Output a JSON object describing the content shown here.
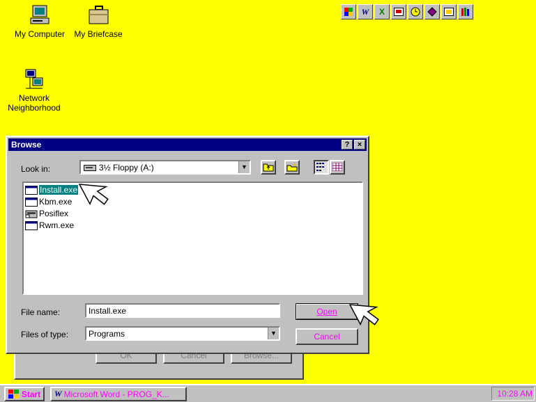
{
  "desktop": {
    "icons": [
      {
        "label": "My Computer"
      },
      {
        "label": "My Briefcase"
      },
      {
        "label": "Network Neighborhood"
      }
    ]
  },
  "office_toolbar": {
    "buttons": [
      "office-logo-icon",
      "word-icon",
      "excel-icon",
      "powerpoint-icon",
      "schedule-icon",
      "access-icon",
      "binder-icon",
      "bookshelf-icon"
    ],
    "word_glyph": "W",
    "excel_glyph": "X"
  },
  "behind_dialog": {
    "buttons": [
      "OK",
      "Cancel",
      "Browse..."
    ]
  },
  "dialog": {
    "title": "Browse",
    "help_glyph": "?",
    "close_glyph": "×",
    "look_in_label": "Look in:",
    "look_in_value": "3½ Floppy (A:)",
    "files": [
      {
        "name": "Install.exe",
        "selected": true
      },
      {
        "name": "Kbm.exe",
        "selected": false
      },
      {
        "name": "Posiflex",
        "selected": false
      },
      {
        "name": "Rwm.exe",
        "selected": false
      }
    ],
    "file_name_label": "File name:",
    "file_name_value": "Install.exe",
    "files_of_type_label": "Files of type:",
    "files_of_type_value": "Programs",
    "open_label": "Open",
    "cancel_label": "Cancel"
  },
  "taskbar": {
    "start_label": "Start",
    "task_label": "Microsoft Word - PROG_K...",
    "clock": "10:28 AM"
  },
  "colors": {
    "desktop": "#ffff00",
    "selection": "#008080",
    "titlebar": "#000080",
    "taskbar_text": "#ff00ff"
  }
}
